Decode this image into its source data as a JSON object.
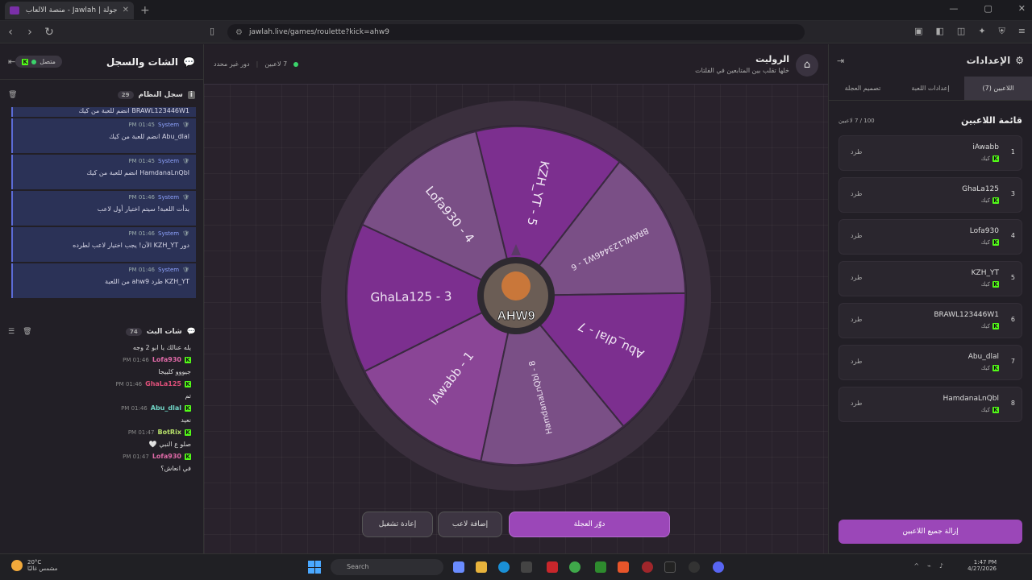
{
  "browser": {
    "tab_title": "جولة | Jawlah - منصة الألعاب التفا",
    "url": "jawlah.live/games/roulette?kick=ahw9"
  },
  "left_panel": {
    "title": "الشات والسجل",
    "status": "متصل",
    "system_log": {
      "title": "سجل النظام",
      "count": "29",
      "top_message": "BRAWL123446W1 انضم للعبة من كيك",
      "items": [
        {
          "sender": "System",
          "time": "01:45 PM",
          "text": "Abu_dlal انضم للعبة من كيك"
        },
        {
          "sender": "System",
          "time": "01:45 PM",
          "text": "HamdanaLnQbl انضم للعبة من كيك"
        },
        {
          "sender": "System",
          "time": "01:46 PM",
          "text": "بدأت اللعبة! سيتم اختيار أول لاعب"
        },
        {
          "sender": "System",
          "time": "01:46 PM",
          "text": "دور KZH_YT الآن! يجب اختيار لاعب لطرده"
        },
        {
          "sender": "System",
          "time": "01:46 PM",
          "text": "KZH_YT طرد ahw9 من اللعبة"
        }
      ]
    },
    "live_chat": {
      "title": "شات البث",
      "count": "74",
      "top_message": "يله عنالك يا ابو 2 وجه",
      "messages": [
        {
          "user": "Lofa930",
          "time": "01:46 PM",
          "text": "جيووو كلييجا",
          "color": "#e06aa8"
        },
        {
          "user": "GhaLa125",
          "time": "01:46 PM",
          "text": "تم",
          "color": "#e0507a"
        },
        {
          "user": "Abu_dlal",
          "time": "01:46 PM",
          "text": "نعيد",
          "color": "#6fd3c4"
        },
        {
          "user": "BotRix",
          "time": "01:47 PM",
          "text": "صلو ع النبي 🤍",
          "color": "#b7e06a"
        },
        {
          "user": "Lofa930",
          "time": "01:47 PM",
          "text": "في انعاش؟",
          "color": "#e06aa8"
        }
      ]
    }
  },
  "center": {
    "title": "الروليت",
    "subtitle": "خلها تقلب بين المتابعين في الفلتات",
    "players_count": "7 لاعبين",
    "turn": "دور غير محدد",
    "logo_text": "AHW9",
    "wheel_segments": [
      {
        "label": "iAwabb - 1",
        "color": "#8a4596"
      },
      {
        "label": "GhaLa125 - 3",
        "color": "#7c2f8f"
      },
      {
        "label": "Lofa930 - 4",
        "color": "#7a4f86"
      },
      {
        "label": "KZH_YT - 5",
        "color": "#7c2f8f"
      },
      {
        "label": "BRAWL123446W1 - 6",
        "color": "#7a4f86"
      },
      {
        "label": "Abu_dlal - 7",
        "color": "#7c2f8f"
      },
      {
        "label": "HamdanaLnQbl - 8",
        "color": "#7a4f86"
      }
    ],
    "buttons": {
      "spin": "دوّر العجلة",
      "add_player": "إضافة لاعب",
      "restart": "إعادة تشغيل"
    }
  },
  "right_panel": {
    "title": "الإعدادات",
    "tabs": [
      "اللاعبين (7)",
      "إعدادات اللعبة",
      "تصميم العجلة"
    ],
    "list_title": "قائمة اللاعبين",
    "list_count": "100 / 7 لاعبين",
    "kick_label": "طرد",
    "platform_label": "كيك",
    "players": [
      {
        "num": "1",
        "name": "iAwabb"
      },
      {
        "num": "3",
        "name": "GhaLa125"
      },
      {
        "num": "4",
        "name": "Lofa930"
      },
      {
        "num": "5",
        "name": "KZH_YT"
      },
      {
        "num": "6",
        "name": "BRAWL123446W1"
      },
      {
        "num": "7",
        "name": "Abu_dlal"
      },
      {
        "num": "8",
        "name": "HamdanaLnQbl"
      }
    ],
    "remove_all": "إزالة جميع اللاعبين"
  },
  "taskbar": {
    "weather_temp": "20°C",
    "weather_desc": "مشمس غالبًا",
    "search": "Search",
    "time": "1:47 PM",
    "date": "4/27/2026"
  }
}
